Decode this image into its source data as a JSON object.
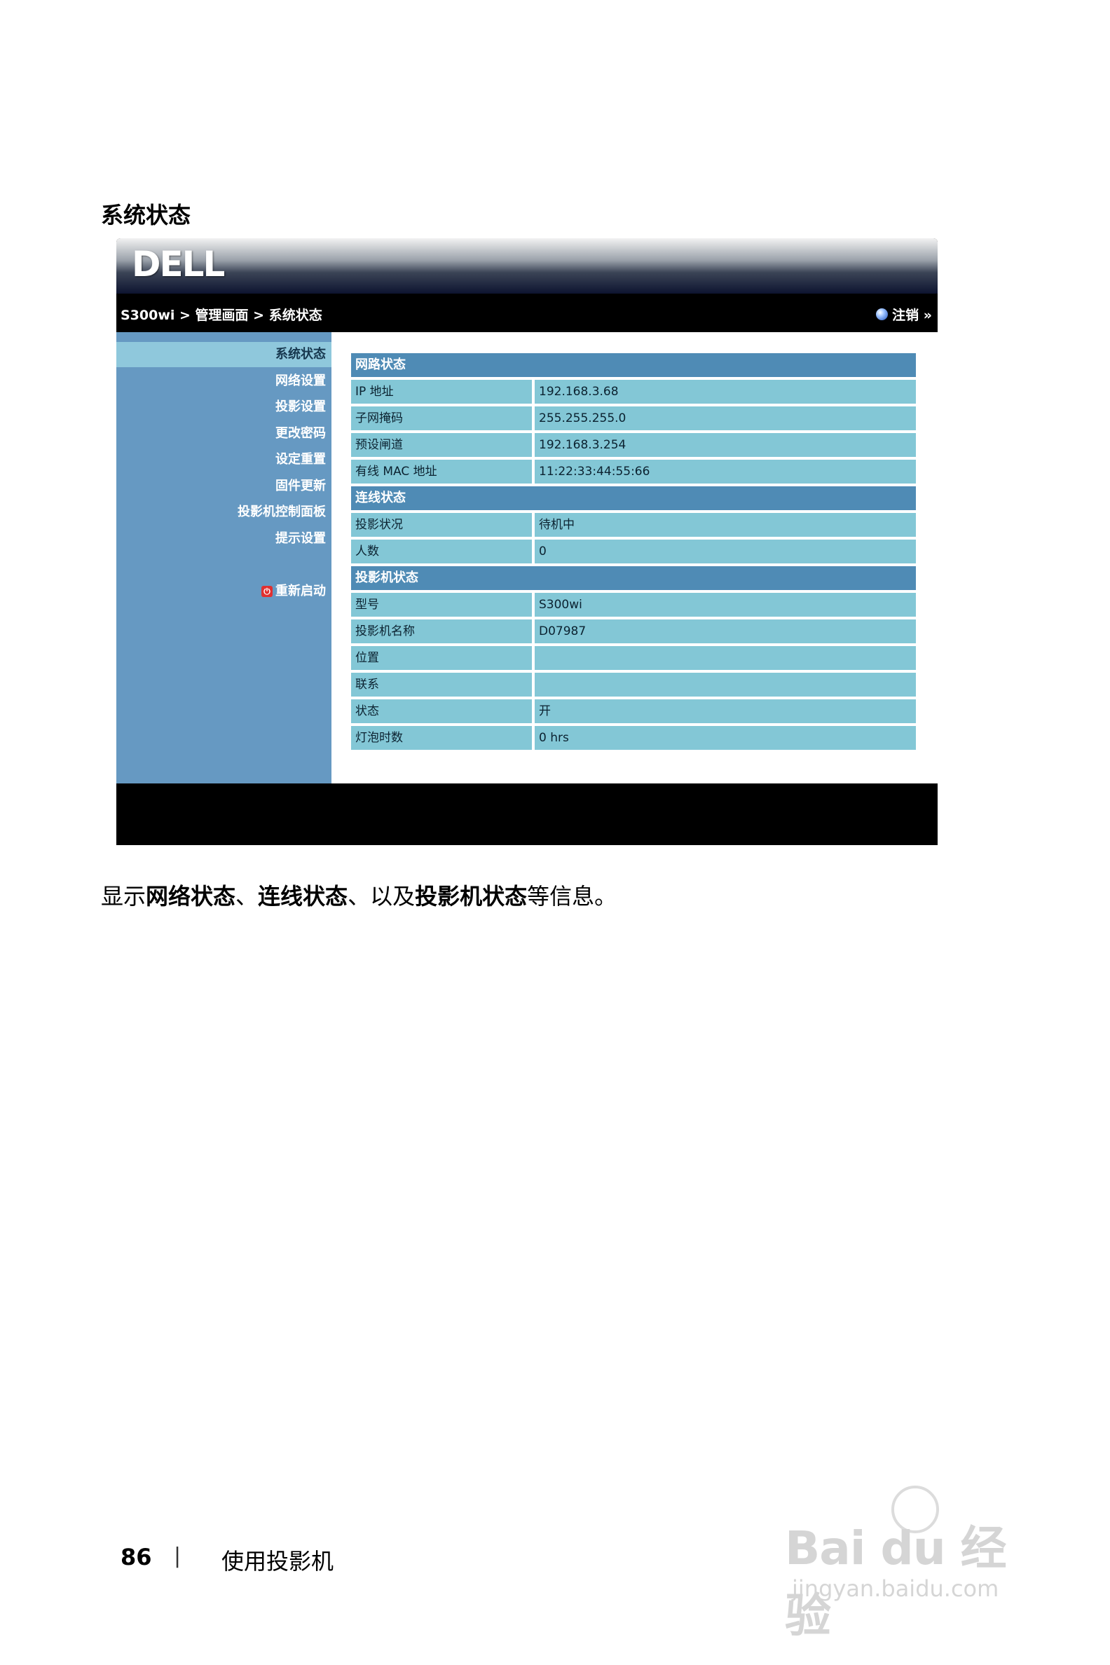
{
  "page": {
    "section_title": "系统状态",
    "description": [
      {
        "text": "显示",
        "bold": false
      },
      {
        "text": "网络状态",
        "bold": true
      },
      {
        "text": "、",
        "bold": false
      },
      {
        "text": "连线状态",
        "bold": true
      },
      {
        "text": "、以及",
        "bold": false
      },
      {
        "text": "投影机状态",
        "bold": true
      },
      {
        "text": "等信息。",
        "bold": false
      }
    ],
    "footer": {
      "page_number": "86",
      "separator": "|",
      "chapter": "使用投影机"
    },
    "watermark": {
      "brand": "Bai du 经验",
      "url": "jingyan.baidu.com"
    }
  },
  "ui": {
    "logo": "DELL",
    "breadcrumb": "S300wi > 管理画面 > 系统状态",
    "logout": "注销 »",
    "nav": [
      {
        "label": "系统状态",
        "active": true
      },
      {
        "label": "网络设置",
        "active": false
      },
      {
        "label": "投影设置",
        "active": false
      },
      {
        "label": "更改密码",
        "active": false
      },
      {
        "label": "设定重置",
        "active": false
      },
      {
        "label": "固件更新",
        "active": false
      },
      {
        "label": "投影机控制面板",
        "active": false
      },
      {
        "label": "提示设置",
        "active": false
      }
    ],
    "reboot": "重新启动",
    "sections": [
      {
        "title": "网路状态",
        "rows": [
          {
            "label": "IP 地址",
            "value": "192.168.3.68"
          },
          {
            "label": "子网掩码",
            "value": "255.255.255.0"
          },
          {
            "label": "预设闸道",
            "value": "192.168.3.254"
          },
          {
            "label": "有线 MAC 地址",
            "value": "11:22:33:44:55:66"
          }
        ]
      },
      {
        "title": "连线状态",
        "rows": [
          {
            "label": "投影状况",
            "value": "待机中"
          },
          {
            "label": "人数",
            "value": "0"
          }
        ]
      },
      {
        "title": "投影机状态",
        "rows": [
          {
            "label": "型号",
            "value": "S300wi"
          },
          {
            "label": "投影机名称",
            "value": "D07987"
          },
          {
            "label": "位置",
            "value": ""
          },
          {
            "label": "联系",
            "value": ""
          },
          {
            "label": "状态",
            "value": "开"
          },
          {
            "label": "灯泡时数",
            "value": "0 hrs"
          }
        ]
      }
    ]
  }
}
